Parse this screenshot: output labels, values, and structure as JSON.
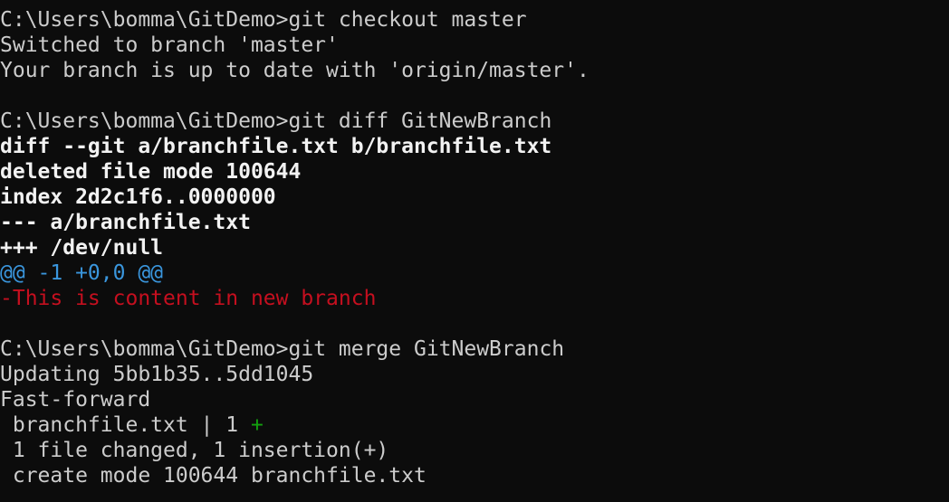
{
  "colors": {
    "background": "#0c0c0c",
    "text": "#cccccc",
    "bold_text": "#f2f2f2",
    "hunk_header": "#3a96dd",
    "deleted_line": "#c50f1f",
    "plus_marker": "#13a10e"
  },
  "block1": {
    "prompt": "C:\\Users\\bomma\\GitDemo>",
    "command": "git checkout master",
    "out1": "Switched to branch 'master'",
    "out2": "Your branch is up to date with 'origin/master'."
  },
  "block2": {
    "prompt": "C:\\Users\\bomma\\GitDemo>",
    "command": "git diff GitNewBranch",
    "diff_header": "diff --git a/branchfile.txt b/branchfile.txt",
    "deleted_mode": "deleted file mode 100644",
    "index": "index 2d2c1f6..0000000",
    "minus_file": "--- a/branchfile.txt",
    "plus_file": "+++ /dev/null",
    "hunk": "@@ -1 +0,0 @@",
    "removed_line": "-This is content in new branch"
  },
  "block3": {
    "prompt": "C:\\Users\\bomma\\GitDemo>",
    "command": "git merge GitNewBranch",
    "updating": "Updating 5bb1b35..5dd1045",
    "fast_forward": "Fast-forward",
    "stat_file": " branchfile.txt | 1 ",
    "stat_plus": "+",
    "summary": " 1 file changed, 1 insertion(+)",
    "create_mode": " create mode 100644 branchfile.txt"
  }
}
